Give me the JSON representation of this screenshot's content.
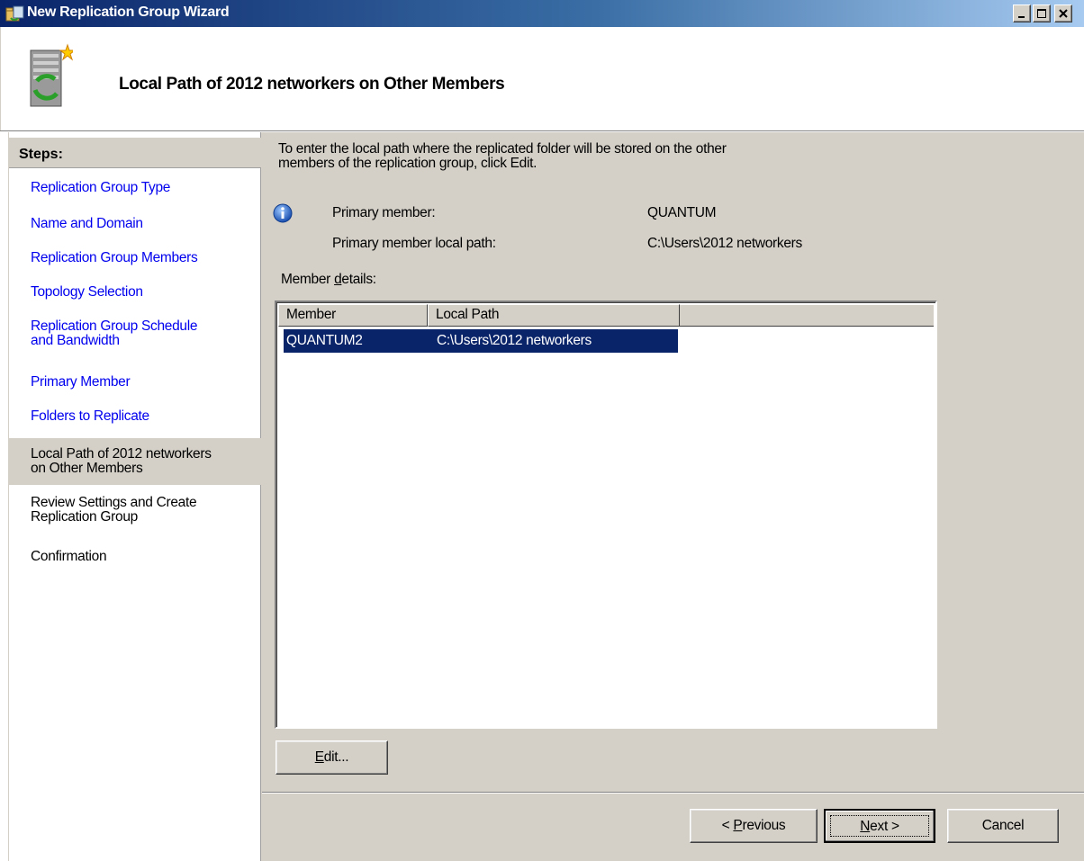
{
  "window": {
    "title": "New Replication Group Wizard"
  },
  "header": {
    "title": "Local Path of 2012 networkers on Other Members",
    "icon": "replication-server-icon"
  },
  "sidebar": {
    "heading": "Steps:",
    "steps": [
      {
        "label_lines": [
          "Replication Group Type"
        ],
        "state": "completed"
      },
      {
        "label_lines": [
          "Name and Domain"
        ],
        "state": "completed"
      },
      {
        "label_lines": [
          "Replication Group Members"
        ],
        "state": "completed"
      },
      {
        "label_lines": [
          "Topology Selection"
        ],
        "state": "completed"
      },
      {
        "label_lines": [
          "Replication Group Schedule",
          "and Bandwidth"
        ],
        "state": "completed"
      },
      {
        "label_lines": [
          "Primary Member"
        ],
        "state": "completed"
      },
      {
        "label_lines": [
          "Folders to Replicate"
        ],
        "state": "completed"
      },
      {
        "label_lines": [
          "Local Path of 2012 networkers",
          "on Other Members"
        ],
        "state": "current"
      },
      {
        "label_lines": [
          "Review Settings and Create",
          "Replication Group"
        ],
        "state": "pending"
      },
      {
        "label_lines": [
          "Confirmation"
        ],
        "state": "pending"
      }
    ]
  },
  "main": {
    "intro_line1": "To enter the local path where the replicated folder will be stored on the other",
    "intro_line2": "members of the replication group, click Edit.",
    "primary_member_label": "Primary member:",
    "primary_member_value": "QUANTUM",
    "primary_path_label": "Primary member local path:",
    "primary_path_value": "C:\\Users\\2012 networkers",
    "member_details_label_pre": "Member ",
    "member_details_label_u": "d",
    "member_details_label_post": "etails:",
    "table": {
      "columns": [
        "Member",
        "Local Path"
      ],
      "rows": [
        {
          "member": "QUANTUM2",
          "local_path": "C:\\Users\\2012 networkers",
          "selected": true
        }
      ]
    },
    "edit_button": {
      "u": "E",
      "rest": "dit..."
    }
  },
  "footer": {
    "previous_button": {
      "pre": "< ",
      "u": "P",
      "rest": "revious"
    },
    "next_button": {
      "u": "N",
      "rest": "ext >"
    },
    "cancel_button": "Cancel"
  },
  "colors": {
    "link": "#0000ee",
    "selection": "#0a246a",
    "titlebar": "#0a246a",
    "face": "#d4d0c8"
  }
}
